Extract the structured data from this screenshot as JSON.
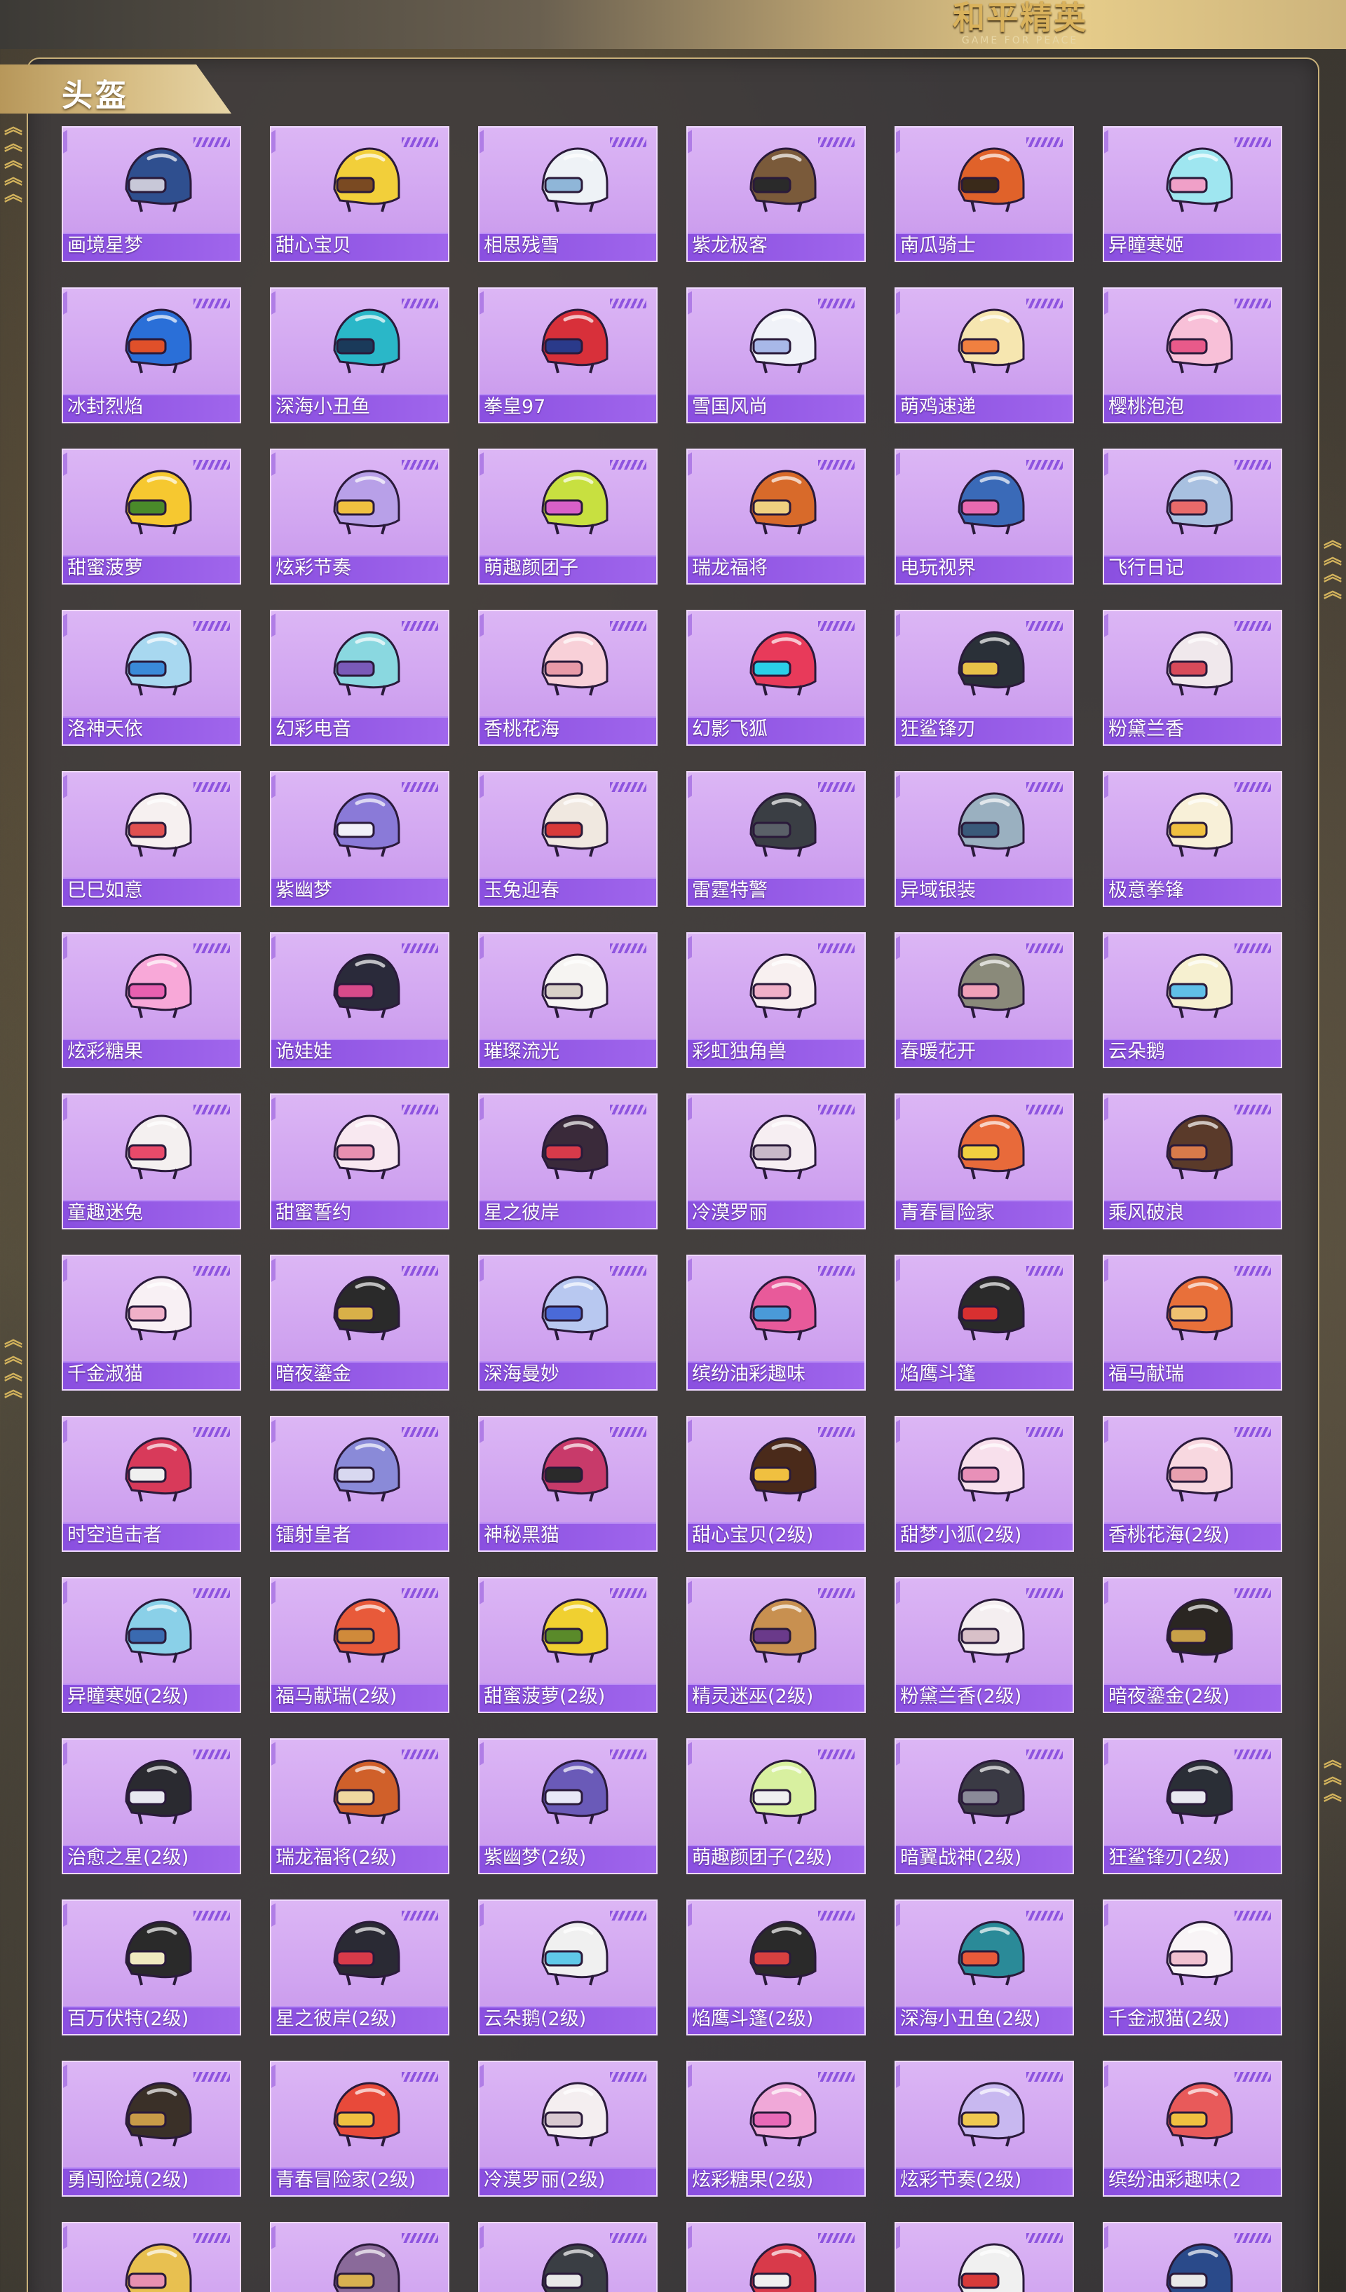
{
  "header": {
    "logo_main": "和平精英",
    "logo_sub": "GAME FOR PEACE"
  },
  "section": {
    "title": "头盔"
  },
  "helmets": [
    {
      "name": "画境星梦",
      "c1": "#2f4f8f",
      "c2": "#c8c8d8"
    },
    {
      "name": "甜心宝贝",
      "c1": "#f2cf3a",
      "c2": "#7a4a22"
    },
    {
      "name": "相思残雪",
      "c1": "#eef2f6",
      "c2": "#8fb6d8"
    },
    {
      "name": "紫龙极客",
      "c1": "#7a5a3a",
      "c2": "#2a2a2a"
    },
    {
      "name": "南瓜骑士",
      "c1": "#e0622a",
      "c2": "#3a2a1a"
    },
    {
      "name": "异瞳寒姬",
      "c1": "#9fe6f0",
      "c2": "#f0a0c8"
    },
    {
      "name": "冰封烈焰",
      "c1": "#2a6fd8",
      "c2": "#e0502a"
    },
    {
      "name": "深海小丑鱼",
      "c1": "#2ab7c8",
      "c2": "#1a3a5a"
    },
    {
      "name": "拳皇97",
      "c1": "#d8303a",
      "c2": "#2a3a8a"
    },
    {
      "name": "雪国风尚",
      "c1": "#f0f2f8",
      "c2": "#a8b8e8"
    },
    {
      "name": "萌鸡速递",
      "c1": "#f6e6b0",
      "c2": "#f08040"
    },
    {
      "name": "樱桃泡泡",
      "c1": "#f8c0d8",
      "c2": "#e85a8a"
    },
    {
      "name": "甜蜜菠萝",
      "c1": "#f6c830",
      "c2": "#4a8a2a"
    },
    {
      "name": "炫彩节奏",
      "c1": "#b8a0e8",
      "c2": "#f0c040"
    },
    {
      "name": "萌趣颜团子",
      "c1": "#c8e040",
      "c2": "#d860c8"
    },
    {
      "name": "瑞龙福将",
      "c1": "#d86a2a",
      "c2": "#f0d080"
    },
    {
      "name": "电玩视界",
      "c1": "#3a6ab8",
      "c2": "#e86ab0"
    },
    {
      "name": "飞行日记",
      "c1": "#a8c0e0",
      "c2": "#e86a6a"
    },
    {
      "name": "洛神天依",
      "c1": "#a8d8f0",
      "c2": "#3a8ad8"
    },
    {
      "name": "幻彩电音",
      "c1": "#8ad8e0",
      "c2": "#7a5ab8"
    },
    {
      "name": "香桃花海",
      "c1": "#f8d0d8",
      "c2": "#e89aa8"
    },
    {
      "name": "幻影飞狐",
      "c1": "#e83a5a",
      "c2": "#2ad0e8"
    },
    {
      "name": "狂鲨锋刃",
      "c1": "#2a3038",
      "c2": "#e8c048"
    },
    {
      "name": "粉黛兰香",
      "c1": "#f0e8ec",
      "c2": "#d84a5a"
    },
    {
      "name": "巳巳如意",
      "c1": "#f6f0f0",
      "c2": "#e05050"
    },
    {
      "name": "紫幽梦",
      "c1": "#8a7ad8",
      "c2": "#f0f0f8"
    },
    {
      "name": "玉兔迎春",
      "c1": "#f0e8e0",
      "c2": "#d83a3a"
    },
    {
      "name": "雷霆特警",
      "c1": "#3a3e44",
      "c2": "#5a6068"
    },
    {
      "name": "异域银装",
      "c1": "#9ab0c0",
      "c2": "#3a5a7a"
    },
    {
      "name": "极意拳锋",
      "c1": "#f8f0d8",
      "c2": "#f0c040"
    },
    {
      "name": "炫彩糖果",
      "c1": "#f8a8d8",
      "c2": "#e860b0"
    },
    {
      "name": "诡娃娃",
      "c1": "#2a2a3a",
      "c2": "#d84a8a"
    },
    {
      "name": "璀璨流光",
      "c1": "#f6f4f2",
      "c2": "#d8d0c8"
    },
    {
      "name": "彩虹独角兽",
      "c1": "#f8f0f0",
      "c2": "#f0b0c8"
    },
    {
      "name": "春暖花开",
      "c1": "#8a8a7a",
      "c2": "#f0a0b8"
    },
    {
      "name": "云朵鹅",
      "c1": "#f6f0d0",
      "c2": "#60c0e8"
    },
    {
      "name": "童趣迷兔",
      "c1": "#f4f0f0",
      "c2": "#e84a6a"
    },
    {
      "name": "甜蜜誓约",
      "c1": "#f8e8f0",
      "c2": "#e890b0"
    },
    {
      "name": "星之彼岸",
      "c1": "#3a2a3a",
      "c2": "#d83a4a"
    },
    {
      "name": "冷漠罗丽",
      "c1": "#f6eef2",
      "c2": "#c8b8c8"
    },
    {
      "name": "青春冒险家",
      "c1": "#e86a3a",
      "c2": "#f0d040"
    },
    {
      "name": "乘风破浪",
      "c1": "#5a3a2a",
      "c2": "#d87a4a"
    },
    {
      "name": "千金淑猫",
      "c1": "#f8f0f4",
      "c2": "#f0b0c8"
    },
    {
      "name": "暗夜鎏金",
      "c1": "#2a2a2a",
      "c2": "#d8b048"
    },
    {
      "name": "深海曼妙",
      "c1": "#b8c8f0",
      "c2": "#4a6ad8"
    },
    {
      "name": "缤纷油彩趣味",
      "c1": "#e85a9a",
      "c2": "#4a9ad8"
    },
    {
      "name": "焰鹰斗篷",
      "c1": "#2a2a2a",
      "c2": "#d83030"
    },
    {
      "name": "福马献瑞",
      "c1": "#e8703a",
      "c2": "#f0c070"
    },
    {
      "name": "时空追击者",
      "c1": "#d83a5a",
      "c2": "#f0f0f0"
    },
    {
      "name": "镭射皇者",
      "c1": "#8a8ad8",
      "c2": "#d8d8f0"
    },
    {
      "name": "神秘黑猫",
      "c1": "#c83a6a",
      "c2": "#2a2a2a"
    },
    {
      "name": "甜心宝贝(2级)",
      "c1": "#4a2a1a",
      "c2": "#f0c040"
    },
    {
      "name": "甜梦小狐(2级)",
      "c1": "#f8e0ec",
      "c2": "#e890b8"
    },
    {
      "name": "香桃花海(2级)",
      "c1": "#f8d8e0",
      "c2": "#e8a0b0"
    },
    {
      "name": "异瞳寒姬(2级)",
      "c1": "#8ad0e8",
      "c2": "#3a6ab0"
    },
    {
      "name": "福马献瑞(2级)",
      "c1": "#e85a3a",
      "c2": "#d08a3a"
    },
    {
      "name": "甜蜜菠萝(2级)",
      "c1": "#f0d030",
      "c2": "#5a8a2a"
    },
    {
      "name": "精灵迷巫(2级)",
      "c1": "#c89050",
      "c2": "#6a3a8a"
    },
    {
      "name": "粉黛兰香(2级)",
      "c1": "#f4eef0",
      "c2": "#d8c0c8"
    },
    {
      "name": "暗夜鎏金(2级)",
      "c1": "#2a2622",
      "c2": "#c8a048"
    },
    {
      "name": "治愈之星(2级)",
      "c1": "#2a2a30",
      "c2": "#e8e8f0"
    },
    {
      "name": "瑞龙福将(2级)",
      "c1": "#d0602a",
      "c2": "#f0d8a0"
    },
    {
      "name": "紫幽梦(2级)",
      "c1": "#6a5ab8",
      "c2": "#e8e8f8"
    },
    {
      "name": "萌趣颜团子(2级)",
      "c1": "#d8f0a0",
      "c2": "#f0f0f0"
    },
    {
      "name": "暗翼战神(2级)",
      "c1": "#3a3a44",
      "c2": "#8a8a98"
    },
    {
      "name": "狂鲨锋刃(2级)",
      "c1": "#2a2e36",
      "c2": "#e8e8f0"
    },
    {
      "name": "百万伏特(2级)",
      "c1": "#2a2a2a",
      "c2": "#f0e8c0"
    },
    {
      "name": "星之彼岸(2级)",
      "c1": "#2a2a34",
      "c2": "#d83a4a"
    },
    {
      "name": "云朵鹅(2级)",
      "c1": "#f0f0f0",
      "c2": "#60c8e8"
    },
    {
      "name": "焰鹰斗篷(2级)",
      "c1": "#2a2a2a",
      "c2": "#d84040"
    },
    {
      "name": "深海小丑鱼(2级)",
      "c1": "#2a8a98",
      "c2": "#e85a3a"
    },
    {
      "name": "千金淑猫(2级)",
      "c1": "#f8f4f6",
      "c2": "#f0c0d0"
    },
    {
      "name": "勇闯险境(2级)",
      "c1": "#3a3028",
      "c2": "#c89a48"
    },
    {
      "name": "青春冒险家(2级)",
      "c1": "#e84a3a",
      "c2": "#f0c040"
    },
    {
      "name": "冷漠罗丽(2级)",
      "c1": "#f4eef0",
      "c2": "#d8c8d0"
    },
    {
      "name": "炫彩糖果(2级)",
      "c1": "#f0a8d8",
      "c2": "#e86ab8"
    },
    {
      "name": "炫彩节奏(2级)",
      "c1": "#c8b8f0",
      "c2": "#f0c850"
    },
    {
      "name": "缤纷油彩趣味(2",
      "c1": "#e85a5a",
      "c2": "#f0c040"
    },
    {
      "name": "",
      "c1": "#e8c050",
      "c2": "#e890b0"
    },
    {
      "name": "",
      "c1": "#8a6a9a",
      "c2": "#d8b050"
    },
    {
      "name": "",
      "c1": "#3a3e44",
      "c2": "#e8e8e8"
    },
    {
      "name": "",
      "c1": "#d83a4a",
      "c2": "#f0f0f0"
    },
    {
      "name": "",
      "c1": "#f0f0f0",
      "c2": "#d83a3a"
    },
    {
      "name": "",
      "c1": "#2a4a8a",
      "c2": "#e8e8e8"
    }
  ]
}
